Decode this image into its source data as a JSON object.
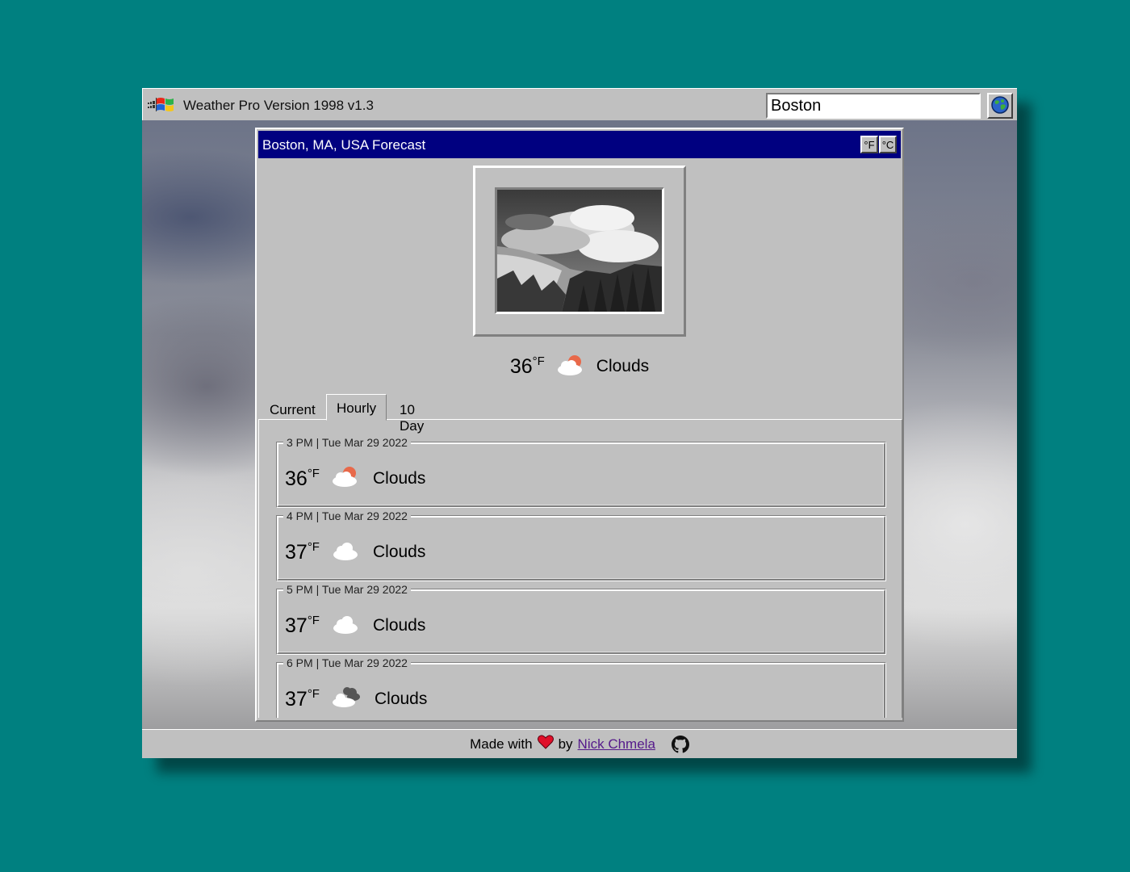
{
  "app": {
    "title": "Weather Pro Version 1998 v1.3",
    "search_value": "Boston",
    "search_button_icon": "globe-icon"
  },
  "forecast": {
    "title": "Boston, MA, USA Forecast",
    "unit_f": "°F",
    "unit_c": "°C",
    "current_temp": "36",
    "current_unit": "°F",
    "current_condition": "Clouds",
    "current_icon": "partly-cloudy-icon"
  },
  "tabs": [
    {
      "label": "Current"
    },
    {
      "label": "Hourly",
      "active": true
    },
    {
      "label": "10 Day"
    }
  ],
  "hourly": [
    {
      "time": "3 PM | Tue Mar 29 2022",
      "temp": "36",
      "unit": "°F",
      "condition": "Clouds",
      "icon": "partly-cloudy-icon"
    },
    {
      "time": "4 PM | Tue Mar 29 2022",
      "temp": "37",
      "unit": "°F",
      "condition": "Clouds",
      "icon": "cloud-icon"
    },
    {
      "time": "5 PM | Tue Mar 29 2022",
      "temp": "37",
      "unit": "°F",
      "condition": "Clouds",
      "icon": "cloud-icon"
    },
    {
      "time": "6 PM | Tue Mar 29 2022",
      "temp": "37",
      "unit": "°F",
      "condition": "Clouds",
      "icon": "overcast-icon"
    }
  ],
  "footer": {
    "made_with": "Made with",
    "heart_icon": "heart-icon",
    "by": "by",
    "author": "Nick Chmela",
    "github_icon": "github-icon"
  },
  "colors": {
    "desktop": "#008080",
    "window_face": "#c0c0c0",
    "titlebar_active": "#000080",
    "heart": "#e0102a"
  }
}
